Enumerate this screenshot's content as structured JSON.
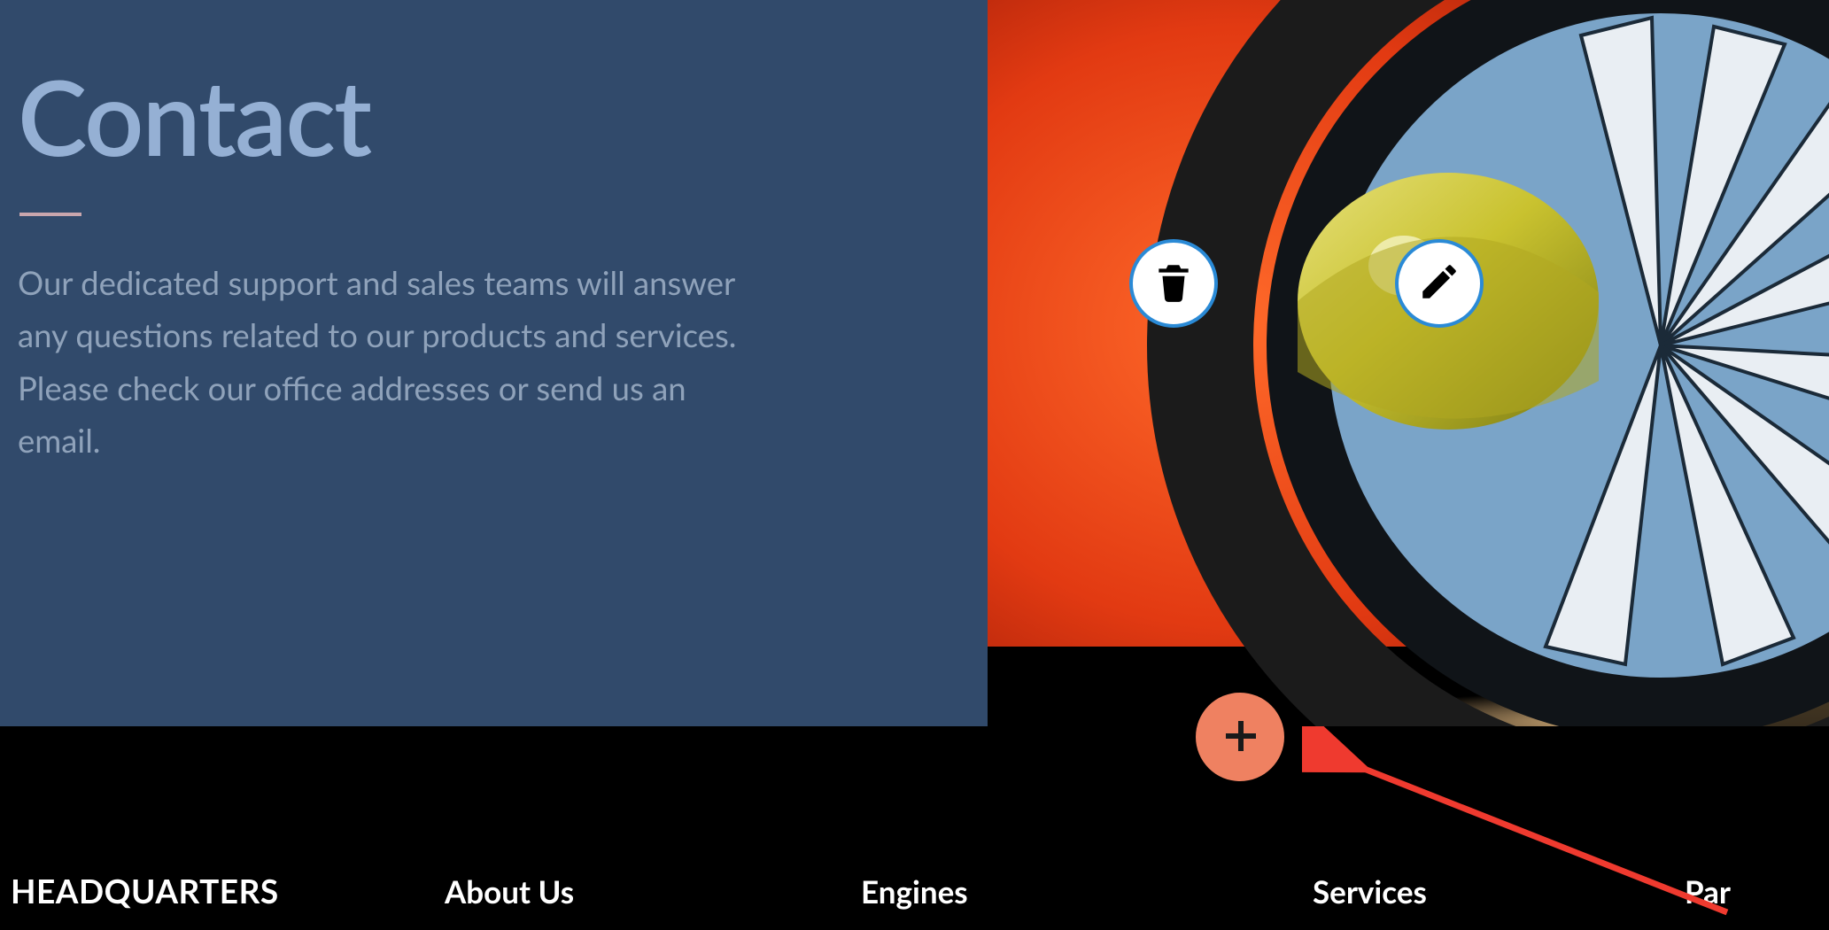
{
  "hero": {
    "title": "Contact",
    "body": "Our dedicated support and sales teams will answer any questions related to our products and services. Please check our office addresses or send us an email."
  },
  "image_overlay": {
    "delete_name": "delete",
    "edit_name": "edit"
  },
  "add_button": {
    "name": "add-section"
  },
  "footer": {
    "heading": "HEADQUARTERS",
    "links": {
      "about": "About Us",
      "engines": "Engines",
      "services": "Services",
      "partners_partial": "Par"
    }
  },
  "colors": {
    "panel_bg": "#314a6b",
    "title": "#95b0d4",
    "accent_add": "#ef8161",
    "btn_border": "#2a8ad6",
    "arrow": "#ef3a2f"
  }
}
